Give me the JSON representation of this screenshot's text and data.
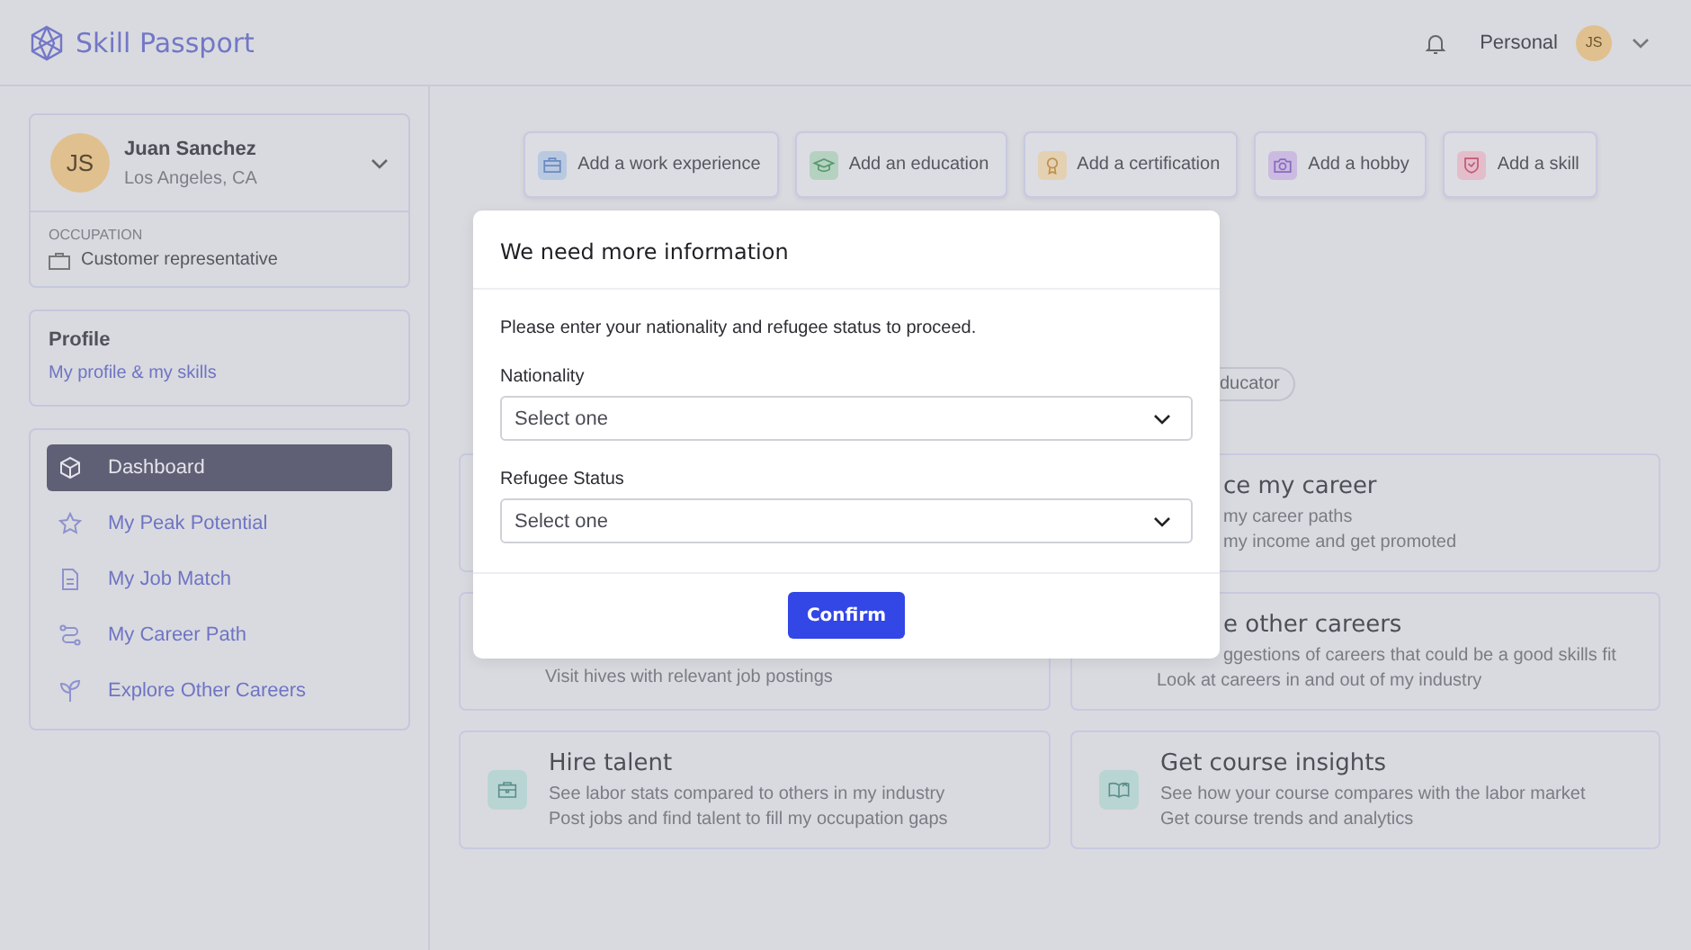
{
  "header": {
    "brand": "Skill Passport",
    "account_label": "Personal",
    "avatar_initials": "JS"
  },
  "sidebar": {
    "user": {
      "initials": "JS",
      "name": "Juan Sanchez",
      "location": "Los Angeles, CA",
      "occupation_label": "OCCUPATION",
      "occupation": "Customer representative"
    },
    "profile": {
      "title": "Profile",
      "link": "My profile & my skills"
    },
    "nav": [
      {
        "label": "Dashboard",
        "selected": true
      },
      {
        "label": "My Peak Potential",
        "selected": false
      },
      {
        "label": "My Job Match",
        "selected": false
      },
      {
        "label": "My Career Path",
        "selected": false
      },
      {
        "label": "Explore Other Careers",
        "selected": false
      }
    ]
  },
  "actions": [
    {
      "label": "Add a work experience",
      "kind": "work",
      "color": "#b9c9e0"
    },
    {
      "label": "Add an education",
      "kind": "education",
      "color": "#b5d2c0"
    },
    {
      "label": "Add a certification",
      "kind": "certification",
      "color": "#e4d1b2"
    },
    {
      "label": "Add a hobby",
      "kind": "hobby",
      "color": "#cbbbe0"
    },
    {
      "label": "Add a skill",
      "kind": "skill",
      "color": "#e4bdca"
    }
  ],
  "chip": {
    "label": "ducator"
  },
  "cards": [
    {
      "kind": "covered",
      "title": {
        "text": "ce my career",
        "kind": "fragment"
      },
      "lines": [
        {
          "text": "my career paths",
          "kind": "fragment"
        },
        {
          "text": "my income and get promoted",
          "kind": "fragment"
        }
      ]
    },
    {
      "kind": "covered",
      "lines": [
        {
          "text": "Visit hives with relevant job postings",
          "kind": "full"
        }
      ]
    },
    {
      "kind": "covered",
      "title": {
        "text": "e other careers",
        "kind": "fragment"
      },
      "lines": [
        {
          "text": "ggestions of careers that could be a good skills fit",
          "kind": "fragment"
        },
        {
          "text": "Look at careers in and out of my industry",
          "kind": "full"
        }
      ]
    },
    {
      "kind": "briefcase",
      "title": {
        "text": "Hire talent",
        "kind": "full"
      },
      "lines": [
        {
          "text": "See labor stats compared to others in my industry",
          "kind": "full"
        },
        {
          "text": "Post jobs and find talent to fill my occupation gaps",
          "kind": "full"
        }
      ]
    },
    {
      "kind": "book",
      "title": {
        "text": "Get course insights",
        "kind": "full"
      },
      "lines": [
        {
          "text": "See how your course compares with the labor market",
          "kind": "full"
        },
        {
          "text": "Get course trends and analytics",
          "kind": "full"
        }
      ]
    }
  ],
  "modal": {
    "title": "We need more information",
    "message": "Please enter your nationality and refugee status to proceed.",
    "fields": [
      {
        "label": "Nationality",
        "placeholder": "Select one"
      },
      {
        "label": "Refugee Status",
        "placeholder": "Select one"
      }
    ],
    "confirm": "Confirm"
  }
}
